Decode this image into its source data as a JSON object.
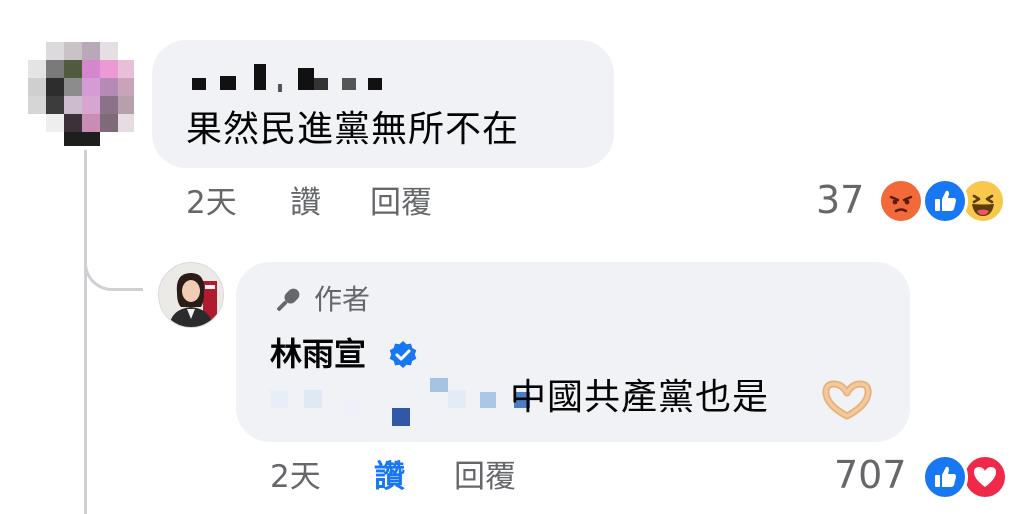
{
  "comment": {
    "text": "果然民進黨無所不在",
    "time": "2天",
    "like_label": "讚",
    "reply_label": "回覆",
    "reaction_count": "37",
    "reactions": [
      "angry",
      "like",
      "haha"
    ]
  },
  "reply": {
    "author_badge": "作者",
    "author_name": "林雨宣",
    "text": "中國共產黨也是",
    "emoji": "🫶🏼",
    "time": "2天",
    "like_label": "讚",
    "reply_label": "回覆",
    "reaction_count": "707",
    "reactions": [
      "like",
      "love"
    ]
  },
  "colors": {
    "bubble": "#f0f2f5",
    "meta_text": "#65676b",
    "like_active": "#1877f2",
    "verified": "#1877f2",
    "thread_line": "#ced0d4"
  }
}
